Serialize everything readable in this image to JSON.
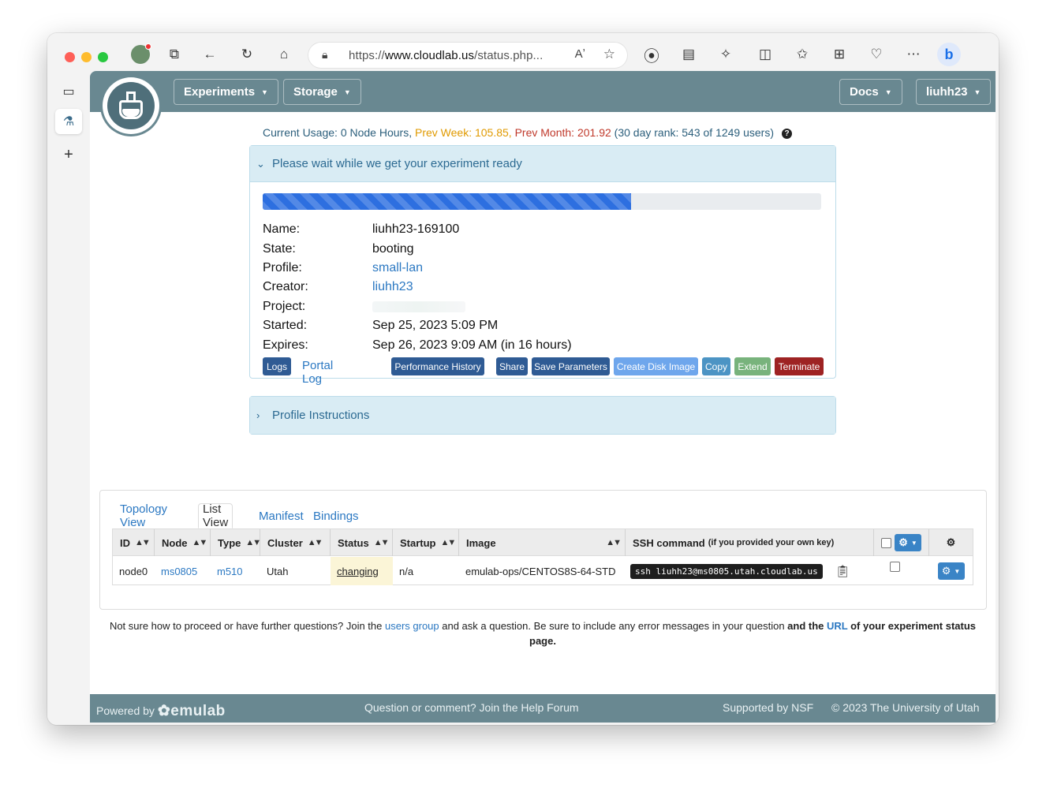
{
  "browser": {
    "url_prefix": "https://",
    "url_host": "www.cloudlab.us",
    "url_path": "/status.php...",
    "read_aloud": "Aʼ",
    "icons": [
      "profile-avatar-icon",
      "tabs-icon",
      "back-icon",
      "refresh-icon",
      "home-icon",
      "lock-icon",
      "read-aloud-icon",
      "favorite-icon",
      "record-icon",
      "reading-list-icon",
      "extensions-icon",
      "split-screen-icon",
      "favorites-icon",
      "collections-icon",
      "performance-icon",
      "more-icon",
      "bing-copilot-icon"
    ],
    "bing": "b"
  },
  "sidebar": {
    "tab_icon": "▭",
    "active_tab_icon": "⚗",
    "new_tab": "+"
  },
  "navbar": {
    "experiments": "Experiments",
    "storage": "Storage",
    "docs": "Docs",
    "user": "liuhh23"
  },
  "usage": {
    "current": "Current Usage: 0 Node Hours, ",
    "prev_week": "Prev Week: 105.85, ",
    "prev_month": "Prev Month: 201.92 ",
    "rank": "(30 day rank: 543 of 1249 users)",
    "help": "?"
  },
  "status_panel": {
    "header": "Please wait while we get your experiment ready",
    "progress": 0.66,
    "fields": {
      "name_label": "Name:",
      "name": "liuhh23-169100",
      "state_label": "State:",
      "state": "booting",
      "profile_label": "Profile:",
      "profile": "small-lan",
      "creator_label": "Creator:",
      "creator": "liuhh23",
      "project_label": "Project:",
      "project": "",
      "started_label": "Started:",
      "started": "Sep 25, 2023 5:09 PM",
      "expires_label": "Expires:",
      "expires": "Sep 26, 2023 9:09 AM (in 16 hours)"
    },
    "buttons": {
      "logs": "Logs",
      "portal_log": "Portal Log",
      "performance_history": "Performance History",
      "share": "Share",
      "save_parameters": "Save Parameters",
      "create_disk_image": "Create Disk Image",
      "copy": "Copy",
      "extend": "Extend",
      "terminate": "Terminate"
    }
  },
  "instructions_panel": {
    "header": "Profile Instructions"
  },
  "topology": {
    "tabs": [
      "Topology View",
      "List View",
      "Manifest",
      "Bindings"
    ],
    "active_tab": "List View",
    "columns": {
      "id": "ID",
      "node": "Node",
      "type": "Type",
      "cluster": "Cluster",
      "status": "Status",
      "startup": "Startup",
      "image": "Image",
      "ssh": "SSH command",
      "ssh_note": "(if you provided your own key)"
    },
    "rows": [
      {
        "id": "node0",
        "node": "ms0805",
        "type": "m510",
        "cluster": "Utah",
        "status": "changing",
        "startup": "n/a",
        "image": "emulab-ops/CENTOS8S-64-STD",
        "ssh": "ssh liuhh23@ms0805.utah.cloudlab.us"
      }
    ]
  },
  "help": {
    "p1": "Not sure how to proceed or have further questions? Join the ",
    "users_group": "users group",
    "p2": " and ask a question. Be sure to include any error messages in your question ",
    "p3": "and the ",
    "url": "URL",
    "p4": " of your experiment status page."
  },
  "footer": {
    "powered_by": "Powered by ",
    "brand": "✿emulab",
    "help_forum": "Question or comment? Join the Help Forum",
    "nsf": "Supported by NSF",
    "copyright": "© 2023 The University of Utah"
  },
  "colors": {
    "navbar": "#698891",
    "panel_head": "#d9ecf4",
    "progress": "#2d6fe0",
    "link": "#2b78c2",
    "terminate": "#9e2323"
  }
}
